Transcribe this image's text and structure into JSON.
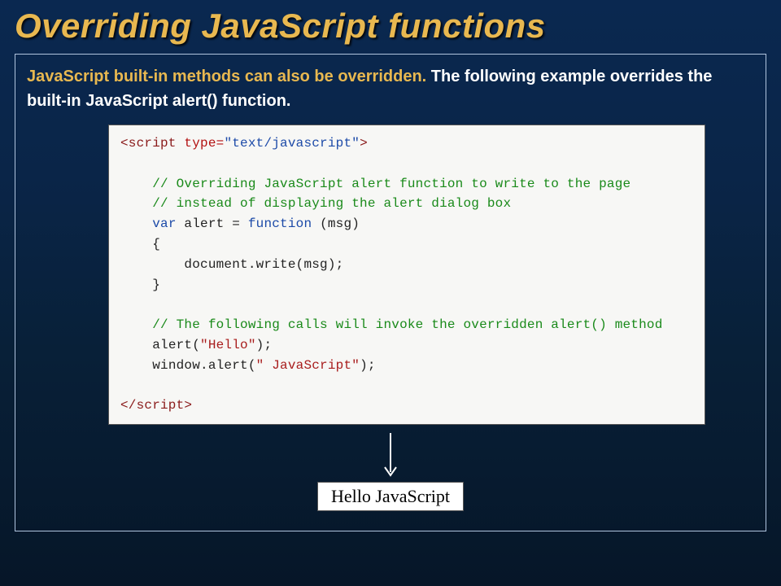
{
  "title": "Overriding JavaScript functions",
  "description_highlight": "JavaScript built-in methods can also be overridden.",
  "description_rest": " The following example overrides the built-in JavaScript alert() function.",
  "code": {
    "open_tag_start": "<script",
    "open_tag_attr": " type=",
    "open_tag_str": "\"text/javascript\"",
    "open_tag_end": ">",
    "c1": "// Overriding JavaScript alert function to write to the page",
    "c2": "// instead of displaying the alert dialog box",
    "kw_var": "var",
    "name_alert": " alert = ",
    "kw_function": "function",
    "params": " (msg)",
    "brace_open": "{",
    "body": "document.write(msg);",
    "brace_close": "}",
    "c3": "// The following calls will invoke the overridden alert() method",
    "call1a": "alert(",
    "call1s": "\"Hello\"",
    "call1b": ");",
    "call2a": "window.alert(",
    "call2s": "\" JavaScript\"",
    "call2b": ");",
    "close_tag": "</script>"
  },
  "output": "Hello JavaScript"
}
